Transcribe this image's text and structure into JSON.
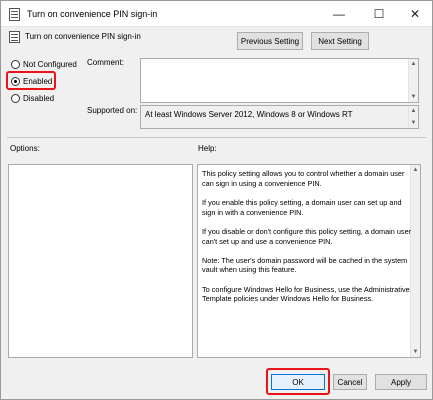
{
  "window": {
    "title": "Turn on convenience PIN sign-in",
    "minimize": "—",
    "maximize": "☐",
    "close": "✕"
  },
  "header": {
    "policy_name": "Turn on convenience PIN sign-in",
    "prev_label": "Previous Setting",
    "next_label": "Next Setting"
  },
  "state": {
    "options": [
      {
        "label": "Not Configured",
        "checked": false
      },
      {
        "label": "Enabled",
        "checked": true
      },
      {
        "label": "Disabled",
        "checked": false
      }
    ]
  },
  "comment": {
    "label": "Comment:",
    "value": ""
  },
  "supported": {
    "label": "Supported on:",
    "value": "At least Windows Server 2012, Windows 8 or Windows RT"
  },
  "options_label": "Options:",
  "help": {
    "label": "Help:",
    "paragraphs": [
      "This policy setting allows you to control whether a domain user can sign in using a convenience PIN.",
      "If you enable this policy setting, a domain user can set up and sign in with a convenience PIN.",
      "If you disable or don't configure this policy setting, a domain user can't set up and use a convenience PIN.",
      "Note: The user's domain password will be cached in the system vault when using this feature.",
      "To configure Windows Hello for Business, use the Administrative Template policies under Windows Hello for Business."
    ]
  },
  "footer": {
    "ok_label": "OK",
    "cancel_label": "Cancel",
    "apply_label": "Apply"
  },
  "icons": {
    "scroll_up": "▲",
    "scroll_down": "▼"
  },
  "colors": {
    "highlight": "#e8141a",
    "ok_border": "#0078d7"
  }
}
